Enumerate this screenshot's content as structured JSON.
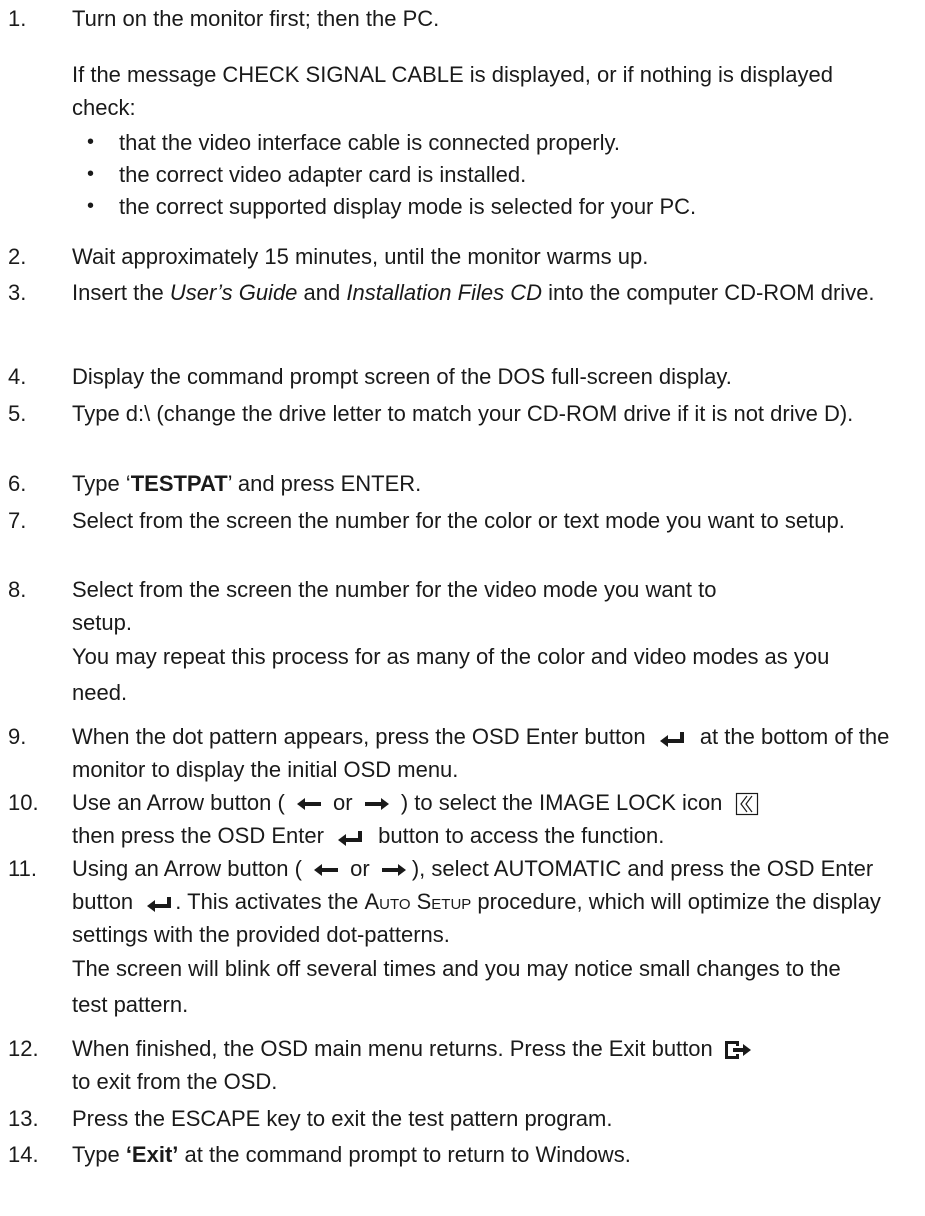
{
  "steps": [
    {
      "num": "1.",
      "text": "Turn on the monitor first; then the PC."
    },
    {
      "num": "2.",
      "text": "Wait approximately 15 minutes, until the monitor warms up."
    },
    {
      "num": "3.",
      "a": "Insert the ",
      "b": "User’s Guide",
      "c": " and ",
      "d": "Installation Files CD",
      "e": " into the computer CD-ROM drive."
    },
    {
      "num": "4.",
      "text": "Display the command prompt screen of the DOS full-screen display."
    },
    {
      "num": "5.",
      "text": "Type d:\\ (change the drive letter to match your CD-ROM drive if it is not drive D)."
    },
    {
      "num": "6.",
      "a": "Type ‘",
      "b": "TESTPAT",
      "c": "’ and press ENTER."
    },
    {
      "num": "7.",
      "text": "Select from the screen the number for the color or text mode you want to setup."
    },
    {
      "num": "8.",
      "text": "Select from the screen the number for the video mode you want to setup."
    },
    {
      "num": "9.",
      "a": "When the dot pattern appears, press the OSD Enter button",
      "b": "at the bottom of the monitor to display the initial OSD menu."
    },
    {
      "num": "10.",
      "a": "Use an Arrow button (",
      "b": "or",
      "c": ") to select the IMAGE LOCK icon",
      "d": "then press the OSD Enter",
      "e": "button to access the function."
    },
    {
      "num": "11.",
      "a": "Using an Arrow button (",
      "b": "or",
      "c": "), select AUTOMATIC and press the OSD Enter button",
      "d": ". This activates the ",
      "e": "Auto Setup",
      "f": " procedure, which will optimize the display settings with the provided dot-patterns."
    },
    {
      "num": "12.",
      "a": "When finished, the OSD main menu returns. Press the Exit button",
      "b": "to exit from the OSD."
    },
    {
      "num": "13.",
      "text": "Press the ESCAPE key to exit the test pattern program."
    },
    {
      "num": "14.",
      "a": "Type ",
      "b": "‘Exit’",
      "c": " at the command prompt to return to Windows."
    }
  ],
  "check_intro": "If the message CHECK SIGNAL CABLE is displayed, or if nothing is displayed check:",
  "check_bullets": [
    "that the video interface cable is connected properly.",
    "the correct video adapter card is installed.",
    "the correct supported display mode is selected for your PC."
  ],
  "note_8": "You may repeat this process for as many of the color and video modes as you need.",
  "note_11": "The screen will blink off several times and you may notice small changes to the test pattern.",
  "bullet_glyph": "•",
  "icons": [
    "enter-icon",
    "left-arrow-icon",
    "right-arrow-icon",
    "image-lock-icon",
    "exit-icon"
  ]
}
